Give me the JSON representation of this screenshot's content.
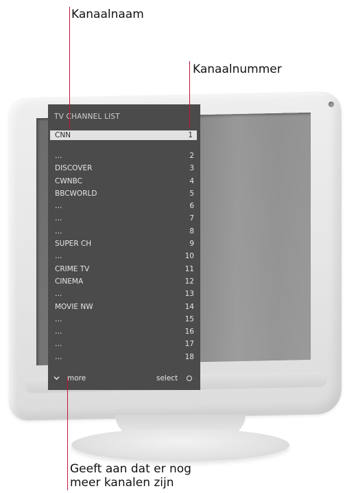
{
  "callouts": {
    "channel_name": "Kanaalnaam",
    "channel_number": "Kanaalnummer",
    "more_indicator_line1": "Geeft aan dat er nog",
    "more_indicator_line2": "meer kanalen zijn"
  },
  "menu": {
    "title": "TV CHANNEL LIST",
    "selected": {
      "name": "CNN",
      "number": "1"
    },
    "rows": [
      {
        "name": "…",
        "number": "2"
      },
      {
        "name": "DISCOVER",
        "number": "3"
      },
      {
        "name": "CWNBC",
        "number": "4"
      },
      {
        "name": "BBCWORLD",
        "number": "5"
      },
      {
        "name": "…",
        "number": "6"
      },
      {
        "name": "…",
        "number": "7"
      },
      {
        "name": "…",
        "number": "8"
      },
      {
        "name": "SUPER CH",
        "number": "9"
      },
      {
        "name": "…",
        "number": "10"
      },
      {
        "name": "CRIME TV",
        "number": "11"
      },
      {
        "name": "CINEMA",
        "number": "12"
      },
      {
        "name": "…",
        "number": "13"
      },
      {
        "name": "MOVIE NW",
        "number": "14"
      },
      {
        "name": "…",
        "number": "15"
      },
      {
        "name": "…",
        "number": "16"
      },
      {
        "name": "…",
        "number": "17"
      },
      {
        "name": "…",
        "number": "18"
      }
    ],
    "footer": {
      "more_label": "more",
      "select_label": "select",
      "more_icon": "chevron-down-icon",
      "select_icon": "circle-icon"
    }
  },
  "colors": {
    "leader_line": "#c4123a",
    "menu_background": "#4b4b4b",
    "highlight": "#e2e2e2"
  }
}
